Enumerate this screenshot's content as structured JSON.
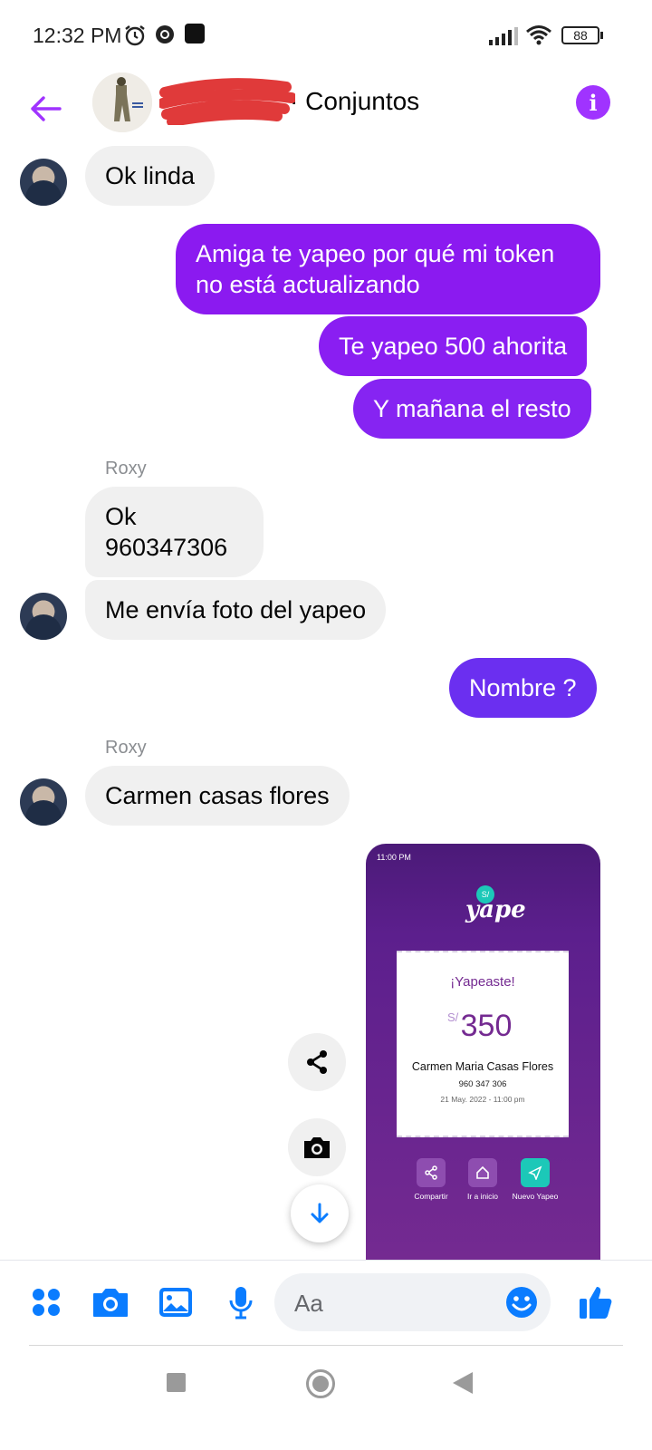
{
  "status_bar": {
    "time": "12:32 PM",
    "battery": "88",
    "icons": [
      "alarm-icon",
      "chrome-icon",
      "app-square-icon",
      "signal-icon",
      "wifi-icon",
      "battery-icon"
    ]
  },
  "header": {
    "title": "· Conjuntos",
    "back_icon": "arrow-left-icon",
    "info_icon": "info-icon",
    "accent_color": "#a033ff"
  },
  "messages": [
    {
      "from": "them",
      "text": "Ok linda"
    },
    {
      "from": "me",
      "text": "Amiga te yapeo por qué mi token\nno está actualizando"
    },
    {
      "from": "me",
      "text": "Te yapeo 500 ahorita"
    },
    {
      "from": "me",
      "text": "Y mañana el resto"
    },
    {
      "from": "them",
      "sender": "Roxy",
      "text": "Ok\n 960347306"
    },
    {
      "from": "them",
      "text": "Me envía foto del yapeo"
    },
    {
      "from": "me",
      "text": "Nombre ?"
    },
    {
      "from": "them",
      "sender": "Roxy",
      "text": "Carmen casas flores"
    }
  ],
  "yape_receipt": {
    "status_time": "11:00 PM",
    "logo": "yape",
    "logo_badge": "S/",
    "title": "¡Yapeaste!",
    "currency": "S/",
    "amount": "350",
    "recipient": "Carmen Maria Casas Flores",
    "phone": "960 347 306",
    "date": "21 May. 2022 - 11:00 pm",
    "actions": [
      {
        "label": "Compartir",
        "icon": "share-icon"
      },
      {
        "label": "Ir a inicio",
        "icon": "home-icon"
      },
      {
        "label": "Nuevo Yapeo",
        "icon": "send-icon"
      }
    ]
  },
  "floating_actions": [
    "share-icon",
    "camera-icon",
    "scroll-down-icon"
  ],
  "composer": {
    "placeholder": "Aa",
    "icons": [
      "menu-dots-icon",
      "camera-icon",
      "gallery-icon",
      "microphone-icon",
      "emoji-icon",
      "like-icon"
    ],
    "accent_color": "#0a7cff"
  },
  "nav_bar": [
    "recents-button",
    "home-button",
    "back-button"
  ]
}
